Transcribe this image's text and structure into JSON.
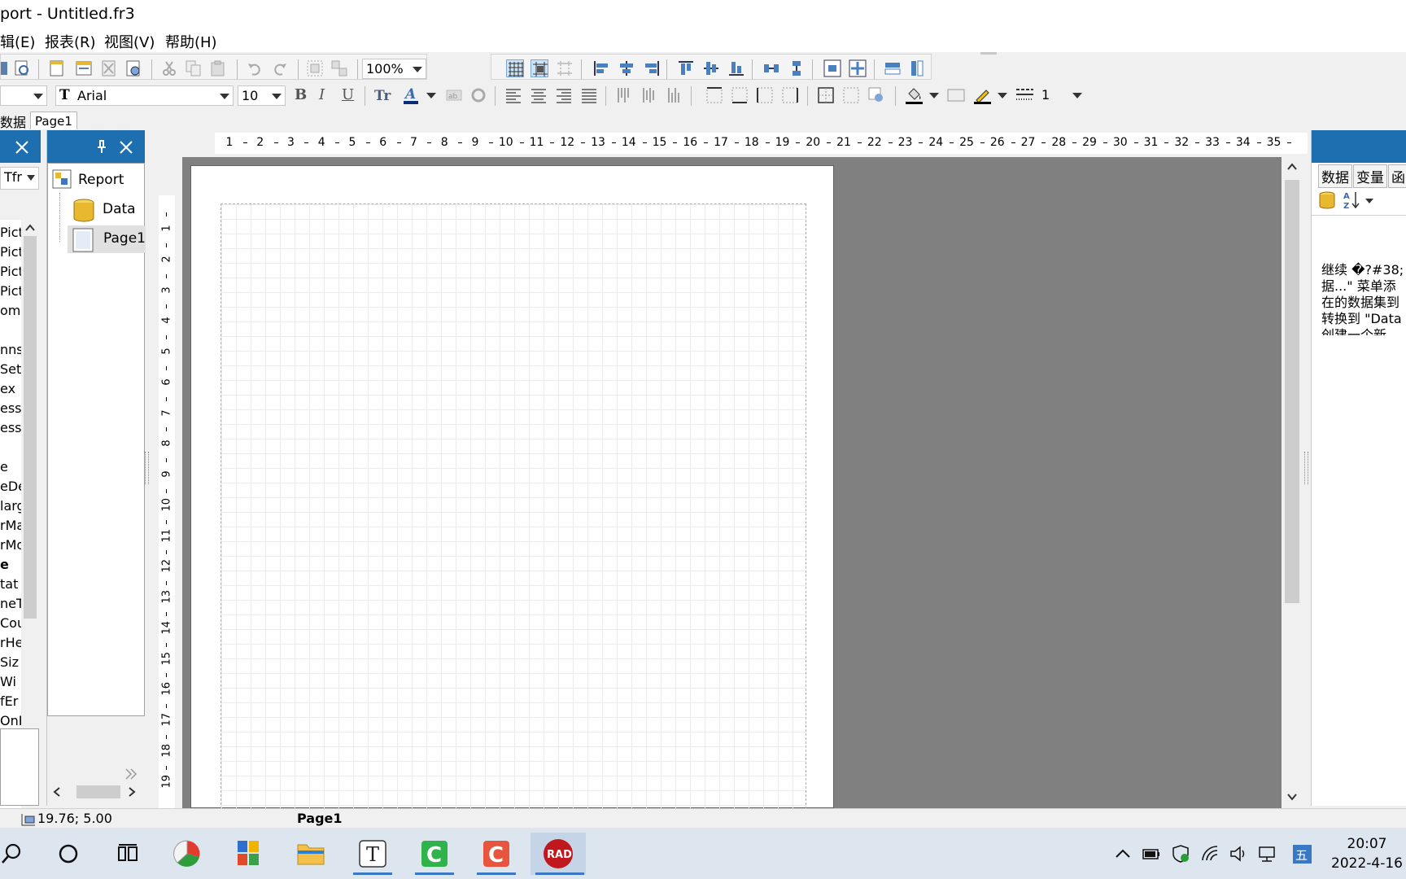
{
  "window": {
    "title": "port - Untitled.fr3"
  },
  "menu": [
    {
      "label": "辑(E)"
    },
    {
      "label": "报表(R)"
    },
    {
      "label": "视图(V)"
    },
    {
      "label": "帮助(H)"
    }
  ],
  "toolbar": {
    "zoom": "100%",
    "font_name": "Arial",
    "font_size": "10",
    "bold": "B",
    "italic": "I",
    "underline": "U",
    "line_width": "1"
  },
  "tabs": {
    "data": "数据",
    "page": "Page1"
  },
  "left_panel": {
    "combo_value": "Tfr",
    "items": [
      "Pict",
      "Pict",
      "Pict",
      "Pict",
      "omN",
      "",
      "nns",
      "Set",
      "ex",
      "ess",
      "ess",
      "",
      "e",
      "eDe",
      "larg",
      "rMa",
      "rMo",
      "e",
      "tat",
      "neT",
      "Cou",
      "rHe",
      "Siz",
      "Wi",
      "fEr",
      "OnP"
    ]
  },
  "tree": {
    "nodes": [
      {
        "label": "Report"
      },
      {
        "label": "Data"
      },
      {
        "label": "Page1"
      }
    ]
  },
  "ruler": {
    "h_ticks": [
      "1",
      "2",
      "3",
      "4",
      "5",
      "6",
      "7",
      "8",
      "9",
      "10",
      "11",
      "12",
      "13",
      "14",
      "15",
      "16",
      "17",
      "18",
      "19",
      "20",
      "21",
      "22",
      "23",
      "24",
      "25",
      "26",
      "27",
      "28",
      "29",
      "30",
      "31",
      "32",
      "33",
      "34",
      "35"
    ],
    "v_ticks": [
      "1",
      "2",
      "3",
      "4",
      "5",
      "6",
      "7",
      "8",
      "9",
      "10",
      "11",
      "12",
      "13",
      "14",
      "15",
      "16",
      "17",
      "18",
      "19"
    ]
  },
  "right_panel": {
    "tabs": [
      "数据",
      "变量",
      "函"
    ],
    "help_lines": [
      "继续 �?#38;",
      "据...\" 菜单添",
      "在的数据集到",
      "转换到 \"Data",
      "创建一个新"
    ]
  },
  "status": {
    "coords": "19.76; 5.00",
    "page": "Page1"
  },
  "taskbar": {
    "time": "20:07",
    "date": "2022-4-16"
  },
  "colors": {
    "panel_header": "#1e6fb0",
    "workspace": "#808080",
    "taskbar": "#dde6ef"
  }
}
